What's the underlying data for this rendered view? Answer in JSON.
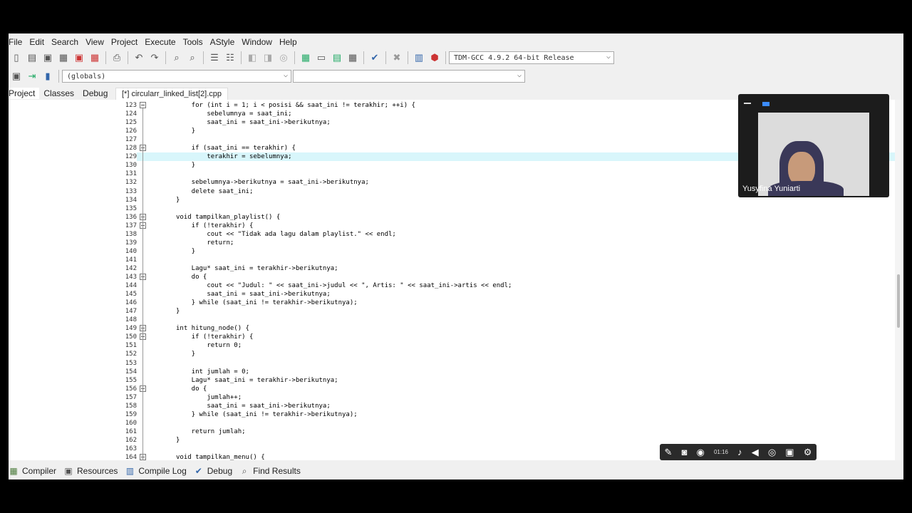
{
  "menu": [
    "File",
    "Edit",
    "Search",
    "View",
    "Project",
    "Execute",
    "Tools",
    "AStyle",
    "Window",
    "Help"
  ],
  "toolbar": {
    "compiler_select": "TDM-GCC 4.9.2 64-bit Release",
    "scope_select": "(globals)",
    "symbol_select": ""
  },
  "left_tabs": [
    "Project",
    "Classes",
    "Debug"
  ],
  "file_tab": "[*] circularr_linked_list[2].cpp",
  "code": [
    {
      "n": "123",
      "t": "    for (int i = 1; i < posisi && saat_ini != terakhir; ++i) {",
      "fold": true
    },
    {
      "n": "124",
      "t": "        sebelumnya = saat_ini;"
    },
    {
      "n": "125",
      "t": "        saat_ini = saat_ini->berikutnya;"
    },
    {
      "n": "126",
      "t": "    }"
    },
    {
      "n": "127",
      "t": ""
    },
    {
      "n": "128",
      "t": "    if (saat_ini == terakhir) {",
      "fold": true
    },
    {
      "n": "129",
      "t": "        terakhir = sebelumnya;",
      "hl": true
    },
    {
      "n": "130",
      "t": "    }"
    },
    {
      "n": "131",
      "t": ""
    },
    {
      "n": "132",
      "t": "    sebelumnya->berikutnya = saat_ini->berikutnya;"
    },
    {
      "n": "133",
      "t": "    delete saat_ini;"
    },
    {
      "n": "134",
      "t": "}"
    },
    {
      "n": "135",
      "t": ""
    },
    {
      "n": "136",
      "t": "void tampilkan_playlist() {",
      "fold": true
    },
    {
      "n": "137",
      "t": "    if (!terakhir) {",
      "fold": true
    },
    {
      "n": "138",
      "t": "        cout << \"Tidak ada lagu dalam playlist.\" << endl;"
    },
    {
      "n": "139",
      "t": "        return;"
    },
    {
      "n": "140",
      "t": "    }"
    },
    {
      "n": "141",
      "t": ""
    },
    {
      "n": "142",
      "t": "    Lagu* saat_ini = terakhir->berikutnya;"
    },
    {
      "n": "143",
      "t": "    do {",
      "fold": true
    },
    {
      "n": "144",
      "t": "        cout << \"Judul: \" << saat_ini->judul << \", Artis: \" << saat_ini->artis << endl;"
    },
    {
      "n": "145",
      "t": "        saat_ini = saat_ini->berikutnya;"
    },
    {
      "n": "146",
      "t": "    } while (saat_ini != terakhir->berikutnya);"
    },
    {
      "n": "147",
      "t": "}"
    },
    {
      "n": "148",
      "t": ""
    },
    {
      "n": "149",
      "t": "int hitung_node() {",
      "fold": true
    },
    {
      "n": "150",
      "t": "    if (!terakhir) {",
      "fold": true
    },
    {
      "n": "151",
      "t": "        return 0;"
    },
    {
      "n": "152",
      "t": "    }"
    },
    {
      "n": "153",
      "t": ""
    },
    {
      "n": "154",
      "t": "    int jumlah = 0;"
    },
    {
      "n": "155",
      "t": "    Lagu* saat_ini = terakhir->berikutnya;"
    },
    {
      "n": "156",
      "t": "    do {",
      "fold": true
    },
    {
      "n": "157",
      "t": "        jumlah++;"
    },
    {
      "n": "158",
      "t": "        saat_ini = saat_ini->berikutnya;"
    },
    {
      "n": "159",
      "t": "    } while (saat_ini != terakhir->berikutnya);"
    },
    {
      "n": "160",
      "t": ""
    },
    {
      "n": "161",
      "t": "    return jumlah;"
    },
    {
      "n": "162",
      "t": "}"
    },
    {
      "n": "163",
      "t": ""
    },
    {
      "n": "164",
      "t": "void tampilkan_menu() {",
      "fold": true
    }
  ],
  "bottom_tabs": [
    "Compiler",
    "Resources",
    "Compile Log",
    "Debug",
    "Find Results"
  ],
  "webcam": {
    "name": "Yusyfina Yuniarti"
  },
  "recorder": {
    "time": "01:16"
  }
}
